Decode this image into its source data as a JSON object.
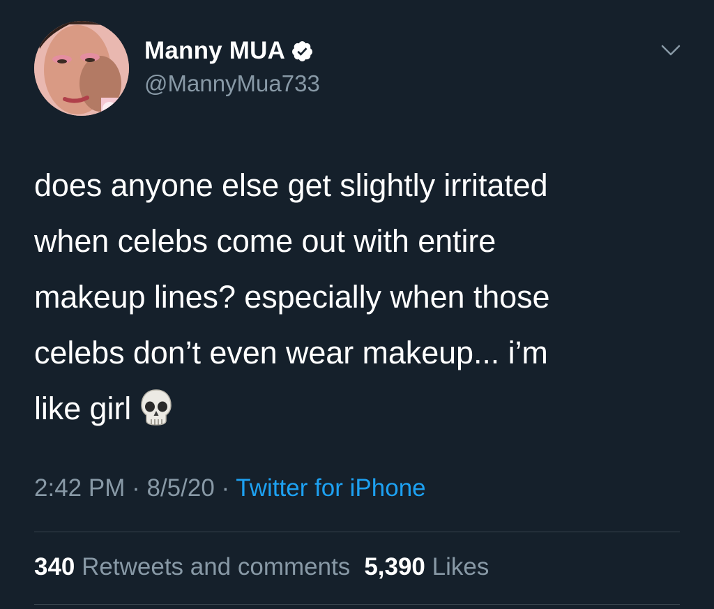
{
  "author": {
    "display_name": "Manny MUA",
    "handle": "@MannyMua733",
    "verified_icon": "verified-badge-icon"
  },
  "tweet": {
    "text": "does anyone else get slightly irritated\nwhen celebs come out with entire\nmakeup lines? especially when those\ncelebs don’t even wear makeup... i’m\nlike girl",
    "emoji": "skull-icon"
  },
  "meta": {
    "time": "2:42 PM",
    "separator": "·",
    "date": "8/5/20",
    "source": "Twitter for iPhone"
  },
  "stats": {
    "retweets_count": "340",
    "retweets_label": "Retweets and comments",
    "likes_count": "5,390",
    "likes_label": "Likes"
  },
  "colors": {
    "background": "#15202b",
    "primary_text": "#ffffff",
    "secondary_text": "#8899a6",
    "link": "#1da1f2",
    "divider": "#38444d"
  }
}
